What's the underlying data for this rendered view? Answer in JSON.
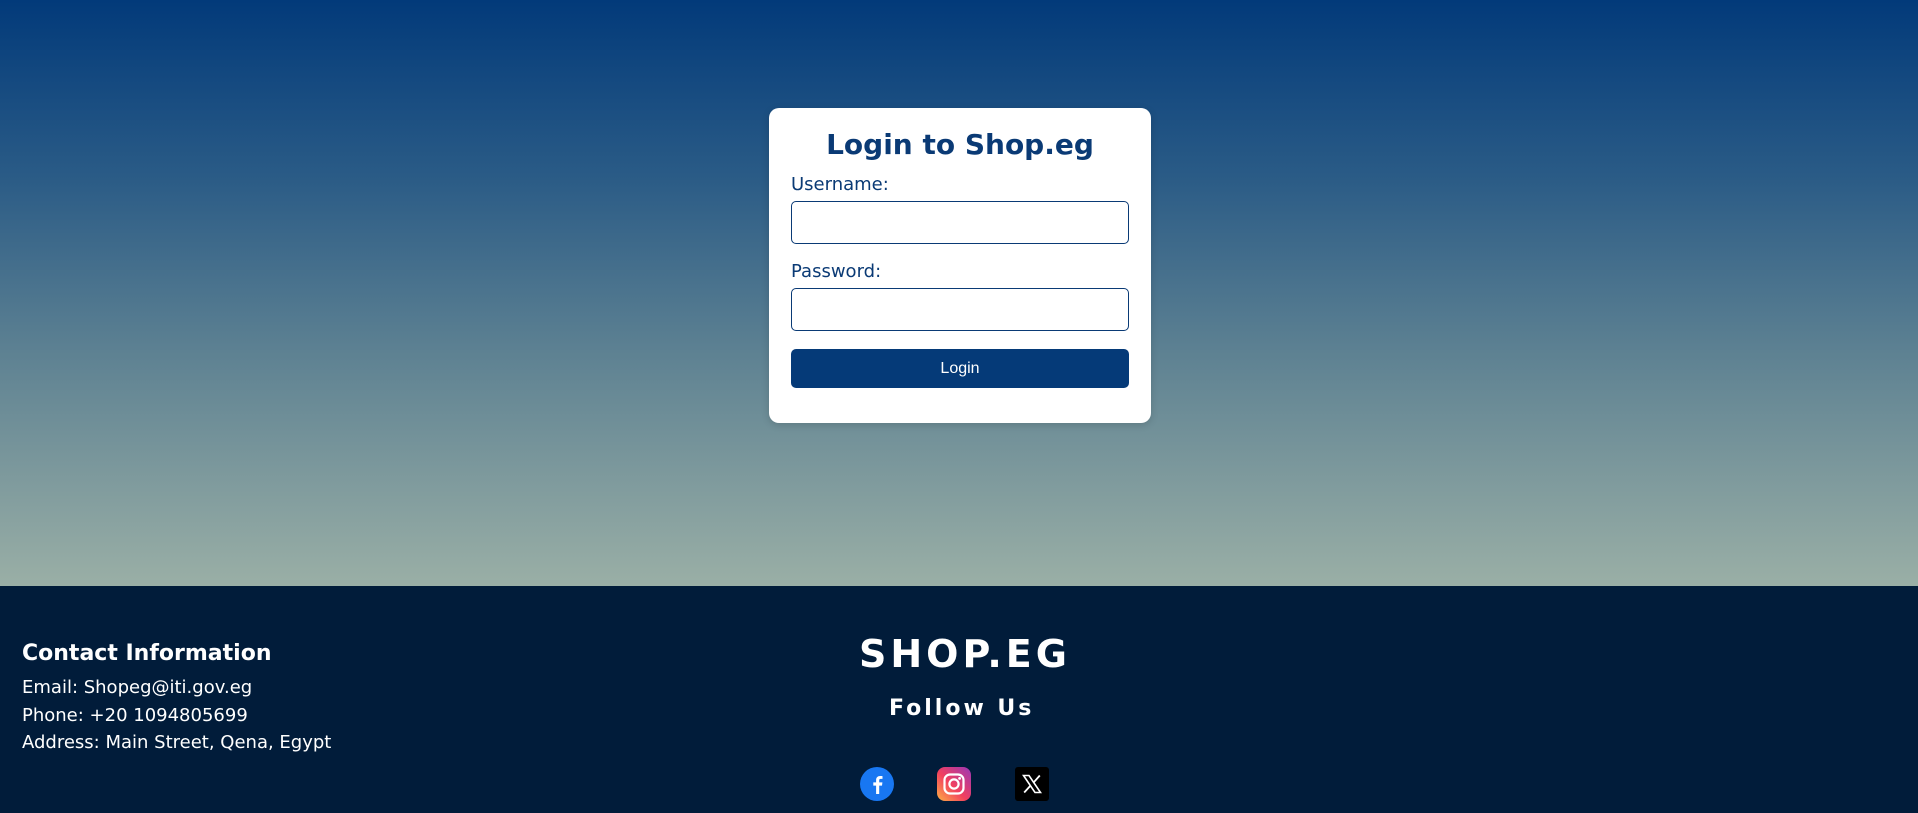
{
  "login": {
    "title": "Login to Shop.eg",
    "username_label": "Username:",
    "username_value": "",
    "password_label": "Password:",
    "password_value": "",
    "submit_label": "Login"
  },
  "footer": {
    "contact": {
      "title": "Contact Information",
      "email": "Email: Shopeg@iti.gov.eg",
      "phone": "Phone: +20 1094805699",
      "address": "Address: Main Street, Qena, Egypt"
    },
    "brand": "SHOP.EG",
    "follow_us": "Follow Us",
    "social_icons": [
      "facebook-icon",
      "instagram-icon",
      "x-icon"
    ]
  },
  "colors": {
    "primary": "#0a3a75",
    "button": "#053a78",
    "footer_bg": "#011c3a",
    "gradient_top": "#023a7a",
    "gradient_bottom": "#9aafa6",
    "facebook": "#1877f2"
  }
}
